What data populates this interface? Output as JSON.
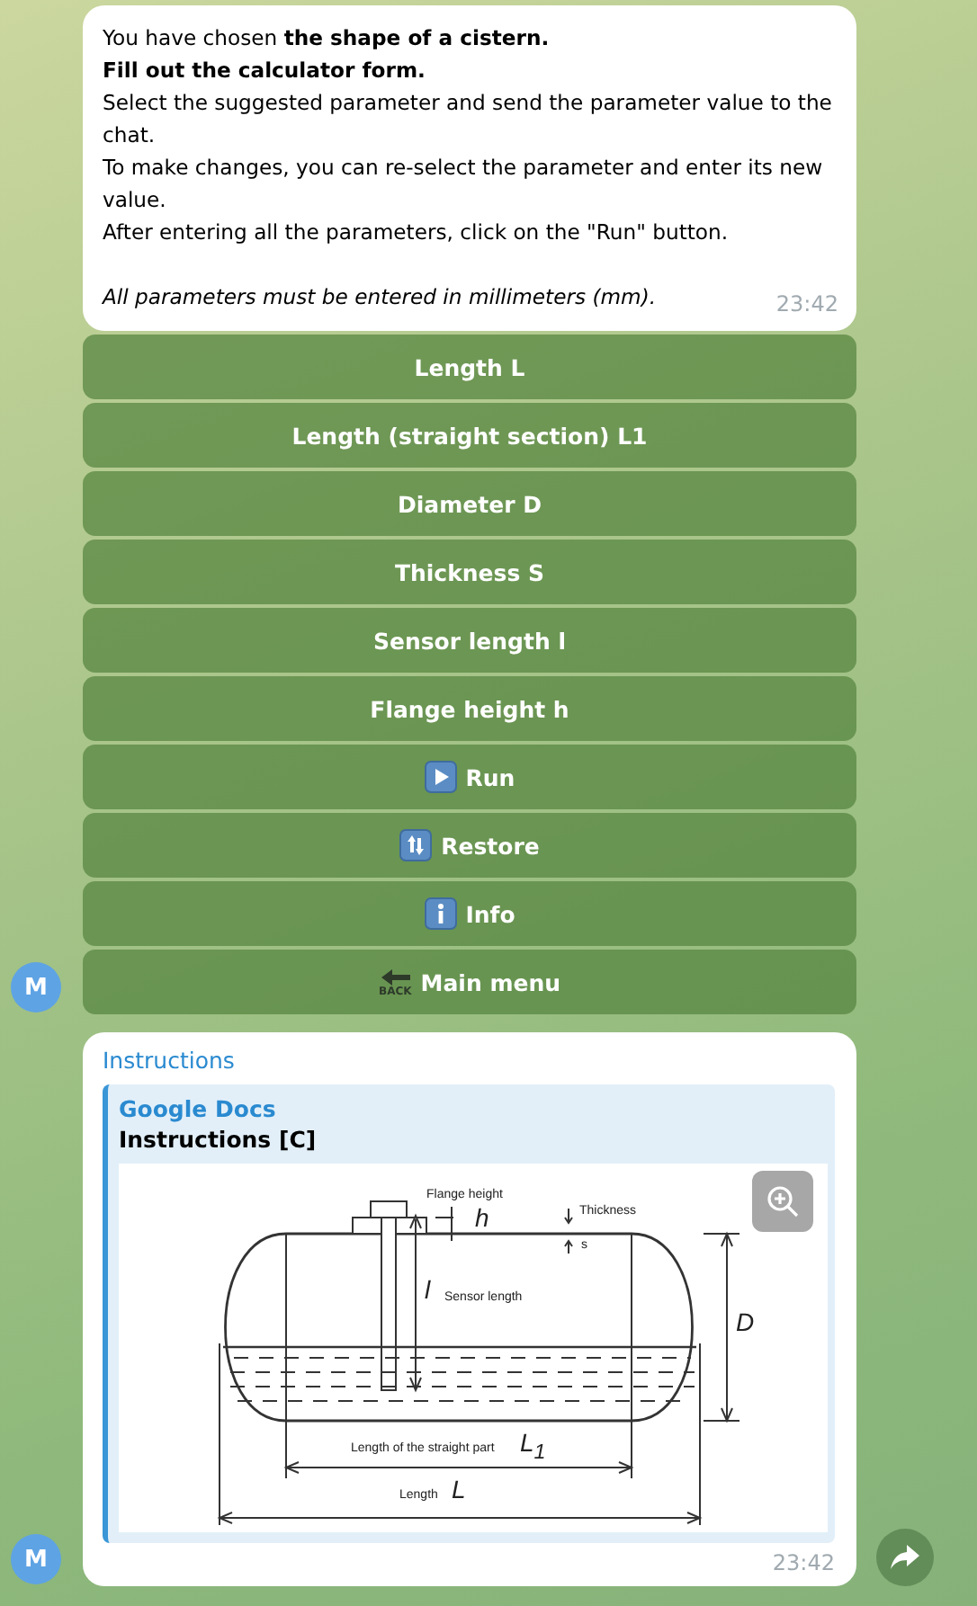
{
  "messages": [
    {
      "kind": "text",
      "avatar": "M",
      "time": "23:42",
      "paragraphs": [
        {
          "kind": "plain",
          "text": "You have chosen **the shape of a cistern.**"
        },
        {
          "kind": "bold",
          "text": "Fill out the calculator form."
        },
        {
          "kind": "plain",
          "text": "Select the suggested parameter and send the parameter value to the chat."
        },
        {
          "kind": "plain",
          "text": "To make changes, you can re-select the parameter and enter its new value."
        },
        {
          "kind": "plain",
          "text": "After entering all the parameters, click on the \"Run\" button."
        },
        {
          "kind": "italic",
          "text": "All parameters must be entered in millimeters (mm)."
        }
      ],
      "keyboard": [
        {
          "label": "Length L"
        },
        {
          "label": "Length (straight section) L1"
        },
        {
          "label": "Diameter D"
        },
        {
          "label": "Thickness S"
        },
        {
          "label": "Sensor length l"
        },
        {
          "label": "Flange height h"
        },
        {
          "label": "Run",
          "kind": "play"
        },
        {
          "label": "Restore",
          "kind": "restore"
        },
        {
          "label": "Info",
          "kind": "info"
        },
        {
          "label": "Main menu",
          "kind": "back",
          "icon_caption": "BACK"
        }
      ]
    },
    {
      "kind": "document",
      "avatar": "M",
      "time": "23:42",
      "text": "Instructions",
      "preview": {
        "site": "Google Docs",
        "title": "Instructions [C]",
        "labels": [
          {
            "kind": "caption",
            "text": "Flange height"
          },
          {
            "kind": "symbol",
            "text": "h"
          },
          {
            "kind": "caption",
            "text": "Thickness"
          },
          {
            "kind": "caption",
            "text": "s"
          },
          {
            "kind": "symbol",
            "text": "l"
          },
          {
            "kind": "caption",
            "text": "Sensor length"
          },
          {
            "kind": "symbol",
            "text": "D"
          },
          {
            "kind": "caption",
            "text": "Length of the straight part"
          },
          {
            "kind": "symbol",
            "text": "L$_{1}$"
          },
          {
            "kind": "caption",
            "text": "Length"
          },
          {
            "kind": "symbol",
            "text": "L"
          }
        ]
      }
    }
  ]
}
